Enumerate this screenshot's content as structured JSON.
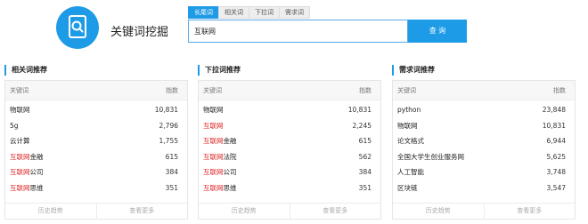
{
  "app": {
    "title": "关键词挖掘"
  },
  "search": {
    "tabs": [
      {
        "label": "长尾词",
        "active": true
      },
      {
        "label": "相关词",
        "active": false
      },
      {
        "label": "下拉词",
        "active": false
      },
      {
        "label": "需求词",
        "active": false
      }
    ],
    "query": "互联网",
    "button_label": "查 询"
  },
  "panels": [
    {
      "title": "相关词推荐",
      "col_keyword": "关键词",
      "col_index": "指数",
      "rows": [
        {
          "prefix": "",
          "rest": "物联网",
          "value": "10,831"
        },
        {
          "prefix": "",
          "rest": "5g",
          "value": "2,796"
        },
        {
          "prefix": "",
          "rest": "云计算",
          "value": "1,755"
        },
        {
          "prefix": "互联网",
          "rest": "金融",
          "value": "615"
        },
        {
          "prefix": "互联网",
          "rest": "公司",
          "value": "384"
        },
        {
          "prefix": "互联网",
          "rest": "思维",
          "value": "351"
        }
      ],
      "footer": {
        "history": "历史趋势",
        "more": "查看更多"
      }
    },
    {
      "title": "下拉词推荐",
      "col_keyword": "关键词",
      "col_index": "指数",
      "rows": [
        {
          "prefix": "",
          "rest": "物联网",
          "value": "10,831"
        },
        {
          "prefix": "互联网",
          "rest": "",
          "value": "2,245"
        },
        {
          "prefix": "互联网",
          "rest": "金融",
          "value": "615"
        },
        {
          "prefix": "互联网",
          "rest": "法院",
          "value": "562"
        },
        {
          "prefix": "互联网",
          "rest": "公司",
          "value": "384"
        },
        {
          "prefix": "互联网",
          "rest": "思维",
          "value": "351"
        }
      ],
      "footer": {
        "history": "历史趋势",
        "more": "查看更多"
      }
    },
    {
      "title": "需求词推荐",
      "col_keyword": "关键词",
      "col_index": "指数",
      "rows": [
        {
          "prefix": "",
          "rest": "python",
          "value": "23,848"
        },
        {
          "prefix": "",
          "rest": "物联网",
          "value": "10,831"
        },
        {
          "prefix": "",
          "rest": "论文格式",
          "value": "6,944"
        },
        {
          "prefix": "",
          "rest": "全国大学生创业服务网",
          "value": "5,625"
        },
        {
          "prefix": "",
          "rest": "人工智能",
          "value": "3,748"
        },
        {
          "prefix": "",
          "rest": "区块链",
          "value": "3,547"
        }
      ],
      "footer": {
        "history": "历史趋势",
        "more": "查看更多"
      }
    }
  ],
  "colors": {
    "accent": "#1e9be6",
    "highlight": "#e02020"
  }
}
